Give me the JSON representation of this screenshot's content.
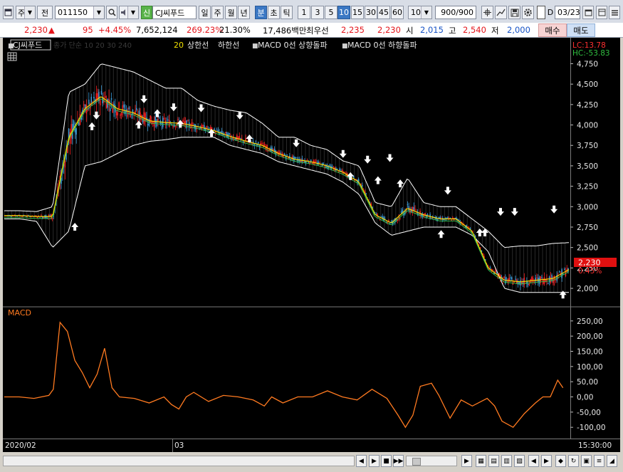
{
  "toolbar": {
    "market_label": "주",
    "market_sub_label": "전",
    "code_value": "011150",
    "stock_badge": "신",
    "stock_name": "CJ씨푸드",
    "period_tabs": [
      "일",
      "주",
      "월",
      "년",
      "분",
      "초",
      "틱"
    ],
    "selected_period": "분",
    "minute_options": [
      "1",
      "3",
      "5",
      "10",
      "15",
      "30",
      "45",
      "60"
    ],
    "selected_minute": "10",
    "interval_value": "10",
    "count_value": "900/900",
    "date_value": "03/23",
    "date_check_label": "D"
  },
  "quote": {
    "price": "2,230",
    "change_arrow": "▲",
    "change": "95",
    "change_pct": "+4.45%",
    "volume": "7,652,124",
    "volume_ratio": "269.23%",
    "turnover": "21.30%",
    "amount": "17,486백만",
    "best_ask_label": "최우선",
    "best_ask": "2,235",
    "best_bid": "2,230",
    "open_label": "시",
    "open": "2,015",
    "high_label": "고",
    "high": "2,540",
    "low_label": "저",
    "low": "2,000",
    "buy_label": "매수",
    "sell_label": "매도"
  },
  "legend": {
    "title_box": "CJ씨푸드",
    "faint": "종가 단순 10 20 30 240",
    "period_num": "20",
    "upper": "상한선",
    "lower": "하한선",
    "macd_up": "MACD 0선 상향돌파",
    "macd_down": "MACD 0선 하향돌파",
    "lc": "LC:13.78",
    "hc": "HC:-53.83"
  },
  "macd_title": "MACD",
  "x_labels": {
    "start": "2020/02",
    "mid": "03",
    "time": "15:30:00"
  },
  "current_price_tag": "2,230",
  "current_pct_tag": "0.45%",
  "colors": {
    "up": "#ff2020",
    "down": "#3a9ad8",
    "ma_yellow": "#f0e000",
    "ma_green": "#36c04a",
    "macd": "#ff7a20",
    "band": "#ffffff",
    "price_tag": "#e01010"
  },
  "chart_data": [
    {
      "type": "candlestick",
      "title": "CJ씨푸드",
      "ylim": [
        1800,
        4850
      ],
      "y_ticks": [
        2000,
        2250,
        2500,
        2750,
        3000,
        3250,
        3500,
        3750,
        4000,
        4250,
        4500,
        4750
      ],
      "y_tick_labels": [
        "2,000",
        "2,250",
        "2,500",
        "2,750",
        "3,000",
        "3,250",
        "3,500",
        "3,750",
        "4,000",
        "4,250",
        "4,500",
        "4,750"
      ],
      "n_bars": 900,
      "series": [
        {
          "name": "상한선",
          "values": [
            2950,
            2950,
            2940,
            3000,
            4400,
            4500,
            4750,
            4700,
            4650,
            4550,
            4450,
            4450,
            4300,
            4230,
            4180,
            4150,
            4020,
            3850,
            3850,
            3750,
            3700,
            3560,
            3500,
            3050,
            3000,
            3350,
            3050,
            3000,
            3000,
            2850,
            2700,
            2500,
            2520,
            2520,
            2550,
            2560
          ]
        },
        {
          "name": "하한선",
          "values": [
            2850,
            2850,
            2820,
            2500,
            2700,
            3500,
            3550,
            3650,
            3750,
            3800,
            3820,
            3850,
            3850,
            3850,
            3750,
            3700,
            3650,
            3550,
            3500,
            3450,
            3400,
            3300,
            3150,
            2800,
            2650,
            2700,
            2750,
            2750,
            2750,
            2650,
            2450,
            2000,
            1950,
            1950,
            1950,
            1950
          ]
        },
        {
          "name": "MA",
          "values": [
            2890,
            2890,
            2880,
            2880,
            3850,
            4200,
            4350,
            4200,
            4150,
            4050,
            4030,
            4020,
            3980,
            3930,
            3860,
            3800,
            3750,
            3650,
            3580,
            3550,
            3500,
            3420,
            3300,
            2900,
            2800,
            2980,
            2900,
            2850,
            2850,
            2700,
            2250,
            2100,
            2080,
            2100,
            2120,
            2230
          ]
        }
      ],
      "signals_up": [
        [
          95,
          2750
        ],
        [
          118,
          3980
        ],
        [
          181,
          4000
        ],
        [
          206,
          4140
        ],
        [
          237,
          4010
        ],
        [
          279,
          3900
        ],
        [
          330,
          3830
        ],
        [
          466,
          3370
        ],
        [
          503,
          3320
        ],
        [
          533,
          3280
        ],
        [
          588,
          2660
        ],
        [
          640,
          2680
        ],
        [
          647,
          2680
        ],
        [
          752,
          1920
        ]
      ],
      "signals_down": [
        [
          124,
          4120
        ],
        [
          188,
          4320
        ],
        [
          228,
          4220
        ],
        [
          265,
          4210
        ],
        [
          317,
          4120
        ],
        [
          393,
          3780
        ],
        [
          456,
          3650
        ],
        [
          489,
          3580
        ],
        [
          519,
          3600
        ],
        [
          597,
          3200
        ],
        [
          668,
          2940
        ],
        [
          687,
          2940
        ],
        [
          740,
          2970
        ]
      ]
    },
    {
      "type": "line",
      "title": "MACD",
      "ylim": [
        -130,
        280
      ],
      "y_ticks": [
        -100,
        -50,
        0,
        50,
        100,
        150,
        200,
        250
      ],
      "y_tick_labels": [
        "-100,00",
        "-50,00",
        "0,00",
        "50,00",
        "100,00",
        "150,00",
        "200,00",
        "250,00"
      ],
      "x": [
        0,
        20,
        40,
        60,
        66,
        75,
        85,
        95,
        105,
        115,
        125,
        135,
        145,
        155,
        175,
        195,
        215,
        225,
        235,
        245,
        255,
        275,
        295,
        315,
        335,
        350,
        360,
        375,
        395,
        415,
        435,
        455,
        475,
        495,
        515,
        530,
        540,
        550,
        560,
        575,
        585,
        600,
        615,
        630,
        650,
        660,
        670,
        685,
        700,
        715,
        725,
        735,
        745,
        752
      ],
      "values": [
        0,
        0,
        -5,
        5,
        25,
        245,
        215,
        120,
        80,
        30,
        75,
        160,
        30,
        0,
        -5,
        -20,
        0,
        -25,
        -40,
        0,
        15,
        -15,
        5,
        0,
        -10,
        -30,
        0,
        -20,
        0,
        0,
        20,
        0,
        -10,
        25,
        -5,
        -60,
        -100,
        -60,
        35,
        45,
        5,
        -70,
        -10,
        -30,
        -5,
        -30,
        -80,
        -100,
        -55,
        -20,
        0,
        0,
        55,
        30
      ]
    }
  ]
}
